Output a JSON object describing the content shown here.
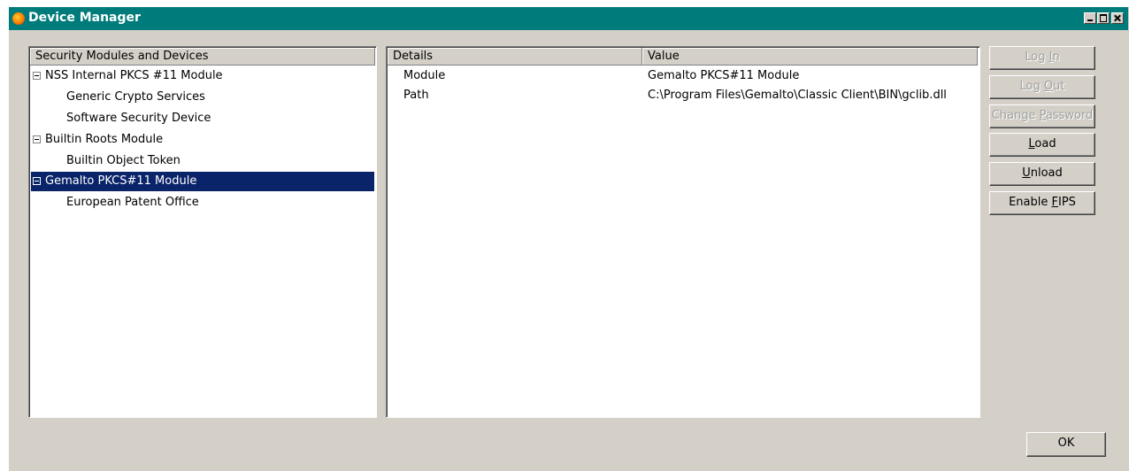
{
  "window": {
    "title": "Device Manager"
  },
  "tree": {
    "header": "Security Modules and Devices",
    "items": [
      {
        "label": "NSS Internal PKCS #11 Module",
        "level": 0,
        "expanded": true,
        "selected": false
      },
      {
        "label": "Generic Crypto Services",
        "level": 1,
        "selected": false
      },
      {
        "label": "Software Security Device",
        "level": 1,
        "selected": false
      },
      {
        "label": "Builtin Roots Module",
        "level": 0,
        "expanded": true,
        "selected": false
      },
      {
        "label": "Builtin Object Token",
        "level": 1,
        "selected": false
      },
      {
        "label": "Gemalto PKCS#11 Module",
        "level": 0,
        "expanded": true,
        "selected": true
      },
      {
        "label": "European Patent Office",
        "level": 1,
        "selected": false
      }
    ]
  },
  "details": {
    "header_details": "Details",
    "header_value": "Value",
    "rows": [
      {
        "key": "Module",
        "value": "Gemalto PKCS#11 Module"
      },
      {
        "key": "Path",
        "value": "C:\\Program Files\\Gemalto\\Classic Client\\BIN\\gclib.dll"
      }
    ]
  },
  "buttons": {
    "login": {
      "pre": "Log ",
      "accel": "I",
      "post": "n",
      "enabled": false
    },
    "logout": {
      "pre": "Log ",
      "accel": "O",
      "post": "ut",
      "enabled": false
    },
    "change_password": {
      "pre": "Change ",
      "accel": "P",
      "post": "assword",
      "enabled": false
    },
    "load": {
      "pre": "",
      "accel": "L",
      "post": "oad",
      "enabled": true
    },
    "unload": {
      "pre": "",
      "accel": "U",
      "post": "nload",
      "enabled": true
    },
    "enable_fips": {
      "pre": "Enable ",
      "accel": "F",
      "post": "IPS",
      "enabled": true
    },
    "ok": "OK"
  },
  "colors": {
    "titlebar": "#007b7b",
    "selection": "#0a246a",
    "face": "#d4d0c8"
  }
}
